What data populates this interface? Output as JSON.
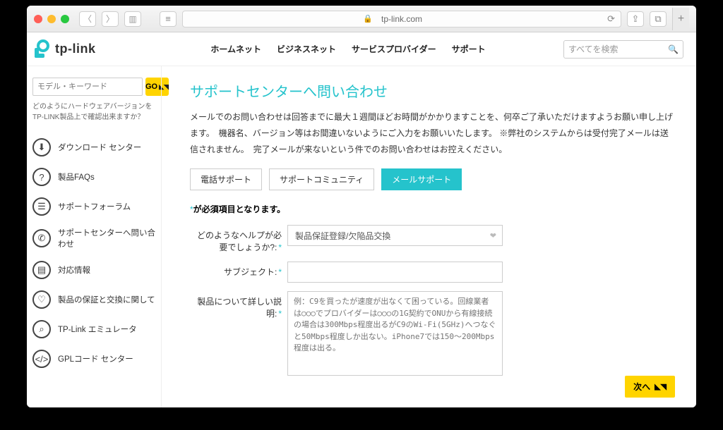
{
  "browser": {
    "url": "tp-link.com"
  },
  "header": {
    "logo_text": "tp-link",
    "menu": [
      "ホームネット",
      "ビジネスネット",
      "サービスプロバイダー",
      "サポート"
    ],
    "search_placeholder": "すべてを検索"
  },
  "sidebar": {
    "keyword_placeholder": "モデル・キーワード",
    "go_label": "GO",
    "note": "どのようにハードウェアバージョンをTP-LINK製品上で確認出来ますか？",
    "items": [
      {
        "icon": "download-icon",
        "label": "ダウンロード センター"
      },
      {
        "icon": "question-icon",
        "label": "製品FAQs"
      },
      {
        "icon": "chat-icon",
        "label": "サポートフォーラム"
      },
      {
        "icon": "phone-icon",
        "label": "サポートセンターへ問い合わせ"
      },
      {
        "icon": "doc-icon",
        "label": "対応情報"
      },
      {
        "icon": "shield-icon",
        "label": "製品の保証と交換に関して"
      },
      {
        "icon": "search-icon",
        "label": "TP-Link エミュレータ"
      },
      {
        "icon": "code-icon",
        "label": "GPLコード センター"
      }
    ]
  },
  "main": {
    "title": "サポートセンターへ問い合わせ",
    "intro": "メールでのお問い合わせは回答までに最大１週間ほどお時間がかかりますことを、何卒ご了承いただけますようお願い申し上げます。　機器名、バージョン等はお間違いないようにご入力をお願いいたします。 ※弊社のシステムからは受付完了メールは送信されません。　完了メールが来ないという件でのお問い合わせはお控えください。",
    "tabs": [
      "電話サポート",
      "サポートコミュニティ",
      "メールサポート"
    ],
    "active_tab_index": 2,
    "required_note_prefix": "*",
    "required_note": "が必須項目となります。",
    "fields": {
      "help_label": "どのようなヘルプが必要でしょうか?:",
      "help_value": "製品保証登録/欠陥品交換",
      "subject_label": "サブジェクト:",
      "detail_label": "製品について詳しい説明:",
      "detail_placeholder": "例：C9を買ったが速度が出なくて困っている。回線業者は○○○でプロバイダーは○○○の1G契約でONUから有線接続の場合は300Mbps程度出るがC9のWi-Fi(5GHz)へつなぐと50Mbps程度しか出ない。iPhone7では150〜200Mbps程度は出る。"
    },
    "next_label": "次へ"
  }
}
